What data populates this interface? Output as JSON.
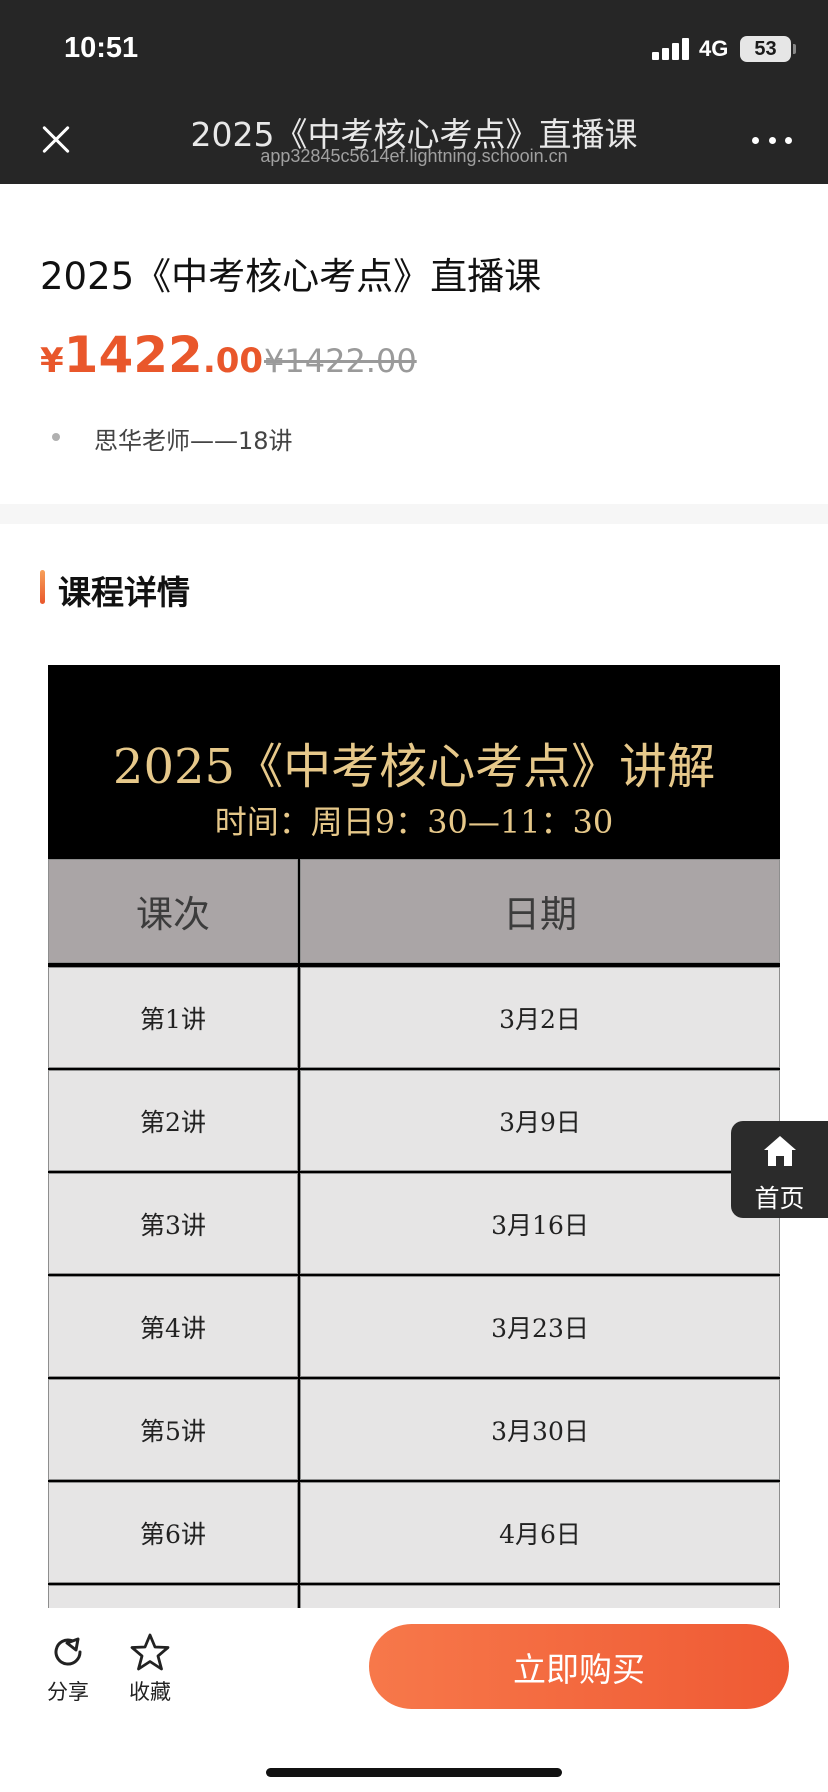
{
  "status_bar": {
    "time": "10:51",
    "network": "4G",
    "battery": "53"
  },
  "nav": {
    "title": "2025《中考核心考点》直播课",
    "url": "app32845c5614ef.lightning.schooin.cn"
  },
  "product": {
    "title": "2025《中考核心考点》直播课",
    "price_symbol": "¥",
    "price_integer": "1422",
    "price_decimal": ".00",
    "original_price": "¥1422.00",
    "teacher_line": "思华老师——18讲"
  },
  "section": {
    "title": "课程详情"
  },
  "poster": {
    "title": "2025《中考核心考点》讲解",
    "subtitle": "时间：周日9：30—11：30",
    "headers": [
      "课次",
      "日期"
    ],
    "rows": [
      [
        "第1讲",
        "3月2日"
      ],
      [
        "第2讲",
        "3月9日"
      ],
      [
        "第3讲",
        "3月16日"
      ],
      [
        "第4讲",
        "3月23日"
      ],
      [
        "第5讲",
        "3月30日"
      ],
      [
        "第6讲",
        "4月6日"
      ],
      [
        "",
        ""
      ]
    ]
  },
  "home_float": {
    "label": "首页",
    "icon": "home-icon"
  },
  "bottom": {
    "share_label": "分享",
    "favorite_label": "收藏",
    "buy_label": "立即购买"
  },
  "colors": {
    "accent": "#e9572b",
    "gold": "#e6c88a"
  }
}
